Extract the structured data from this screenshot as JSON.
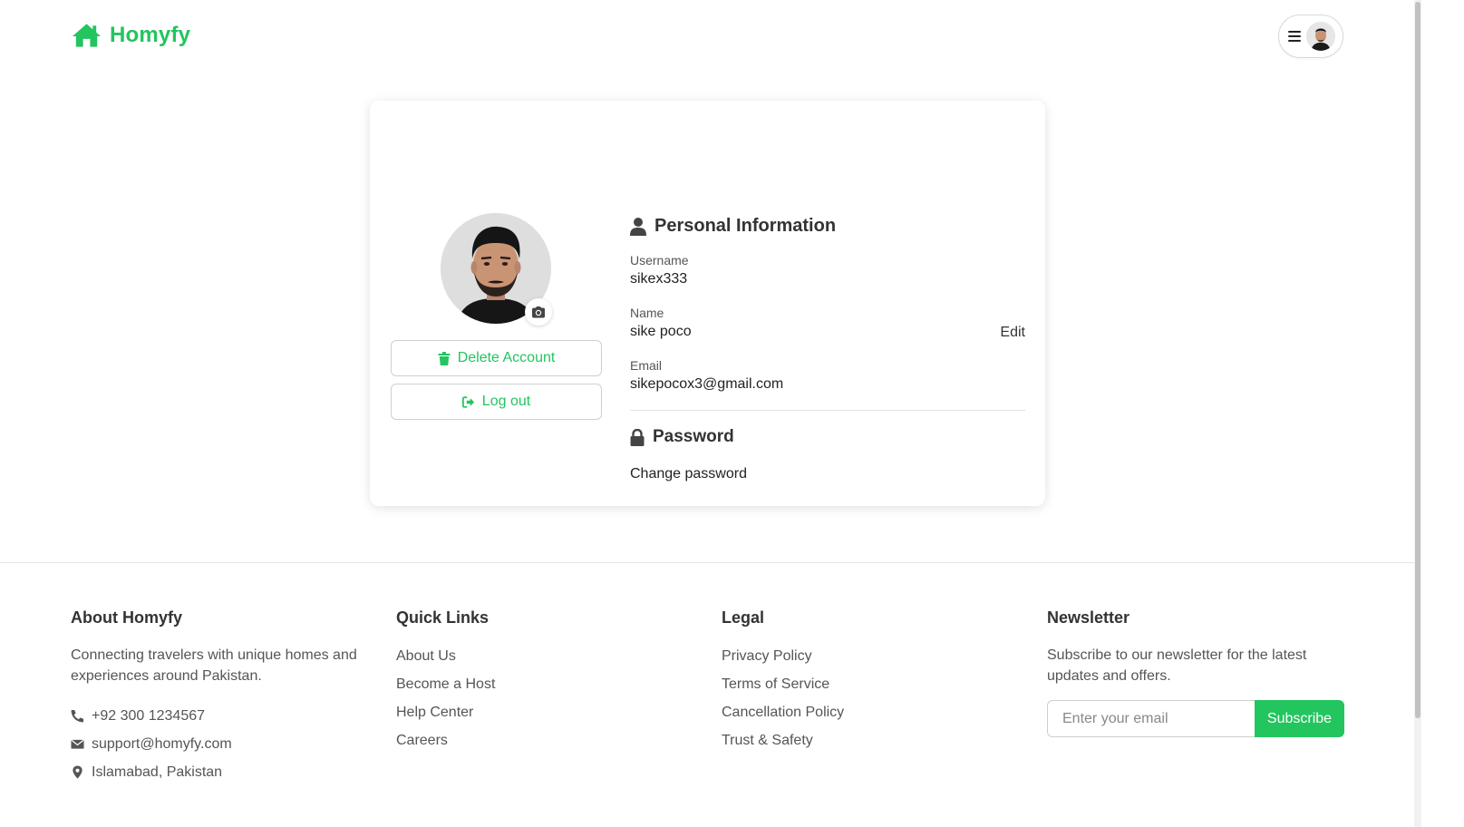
{
  "header": {
    "logo_text": "Homyfy",
    "logo_icon": "house-icon",
    "menu_icon": "hamburger-icon"
  },
  "profile": {
    "delete_label": "Delete Account",
    "logout_label": "Log out",
    "camera_icon": "camera-icon"
  },
  "personal_info": {
    "title": "Personal Information",
    "username_label": "Username",
    "username_value": "sikex333",
    "name_label": "Name",
    "name_value": "sike poco",
    "edit_label": "Edit",
    "email_label": "Email",
    "email_value": "sikepocox3@gmail.com"
  },
  "password": {
    "title": "Password",
    "change_label": "Change password"
  },
  "footer": {
    "about": {
      "title": "About Homyfy",
      "description": "Connecting travelers with unique homes and experiences around Pakistan.",
      "phone": "+92 300 1234567",
      "email": "support@homyfy.com",
      "location": "Islamabad, Pakistan"
    },
    "quick_links": {
      "title": "Quick Links",
      "items": [
        "About Us",
        "Become a Host",
        "Help Center",
        "Careers"
      ]
    },
    "legal": {
      "title": "Legal",
      "items": [
        "Privacy Policy",
        "Terms of Service",
        "Cancellation Policy",
        "Trust & Safety"
      ]
    },
    "newsletter": {
      "title": "Newsletter",
      "description": "Subscribe to our newsletter for the latest updates and offers.",
      "placeholder": "Enter your email",
      "button": "Subscribe"
    }
  },
  "colors": {
    "brand": "#22c55e",
    "text": "#222222",
    "muted": "#555555"
  }
}
